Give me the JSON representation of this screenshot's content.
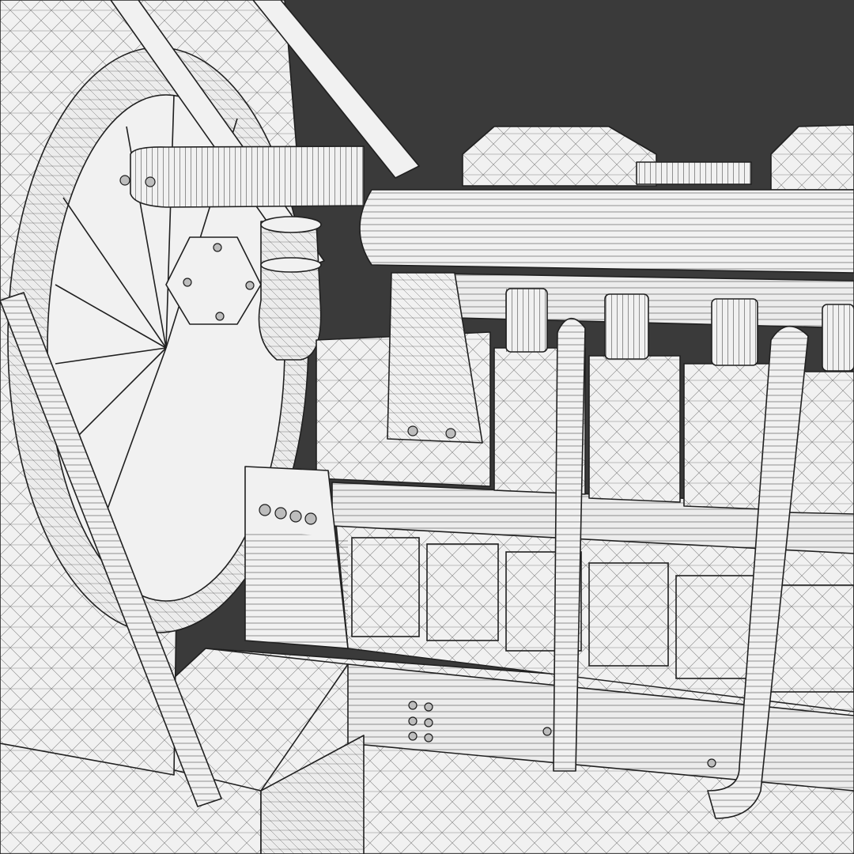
{
  "scene": {
    "background_color": "#3a3a3a",
    "model_fill_color": "#f1f1f1",
    "wire_color": "#202020",
    "display_mode": "wireframe-on-shaded",
    "subject": "industrial-diesel-engine-generator"
  }
}
